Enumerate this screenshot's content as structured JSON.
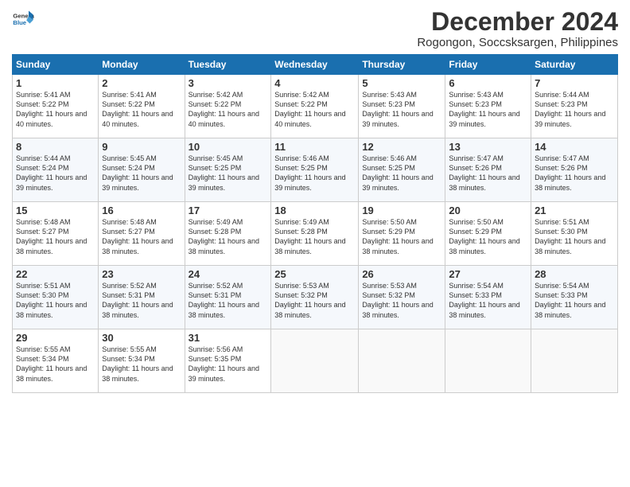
{
  "logo": {
    "general": "General",
    "blue": "Blue"
  },
  "title": "December 2024",
  "subtitle": "Rogongon, Soccsksargen, Philippines",
  "days_header": [
    "Sunday",
    "Monday",
    "Tuesday",
    "Wednesday",
    "Thursday",
    "Friday",
    "Saturday"
  ],
  "weeks": [
    [
      {
        "day": "1",
        "sunrise": "Sunrise: 5:41 AM",
        "sunset": "Sunset: 5:22 PM",
        "daylight": "Daylight: 11 hours and 40 minutes."
      },
      {
        "day": "2",
        "sunrise": "Sunrise: 5:41 AM",
        "sunset": "Sunset: 5:22 PM",
        "daylight": "Daylight: 11 hours and 40 minutes."
      },
      {
        "day": "3",
        "sunrise": "Sunrise: 5:42 AM",
        "sunset": "Sunset: 5:22 PM",
        "daylight": "Daylight: 11 hours and 40 minutes."
      },
      {
        "day": "4",
        "sunrise": "Sunrise: 5:42 AM",
        "sunset": "Sunset: 5:22 PM",
        "daylight": "Daylight: 11 hours and 40 minutes."
      },
      {
        "day": "5",
        "sunrise": "Sunrise: 5:43 AM",
        "sunset": "Sunset: 5:23 PM",
        "daylight": "Daylight: 11 hours and 39 minutes."
      },
      {
        "day": "6",
        "sunrise": "Sunrise: 5:43 AM",
        "sunset": "Sunset: 5:23 PM",
        "daylight": "Daylight: 11 hours and 39 minutes."
      },
      {
        "day": "7",
        "sunrise": "Sunrise: 5:44 AM",
        "sunset": "Sunset: 5:23 PM",
        "daylight": "Daylight: 11 hours and 39 minutes."
      }
    ],
    [
      {
        "day": "8",
        "sunrise": "Sunrise: 5:44 AM",
        "sunset": "Sunset: 5:24 PM",
        "daylight": "Daylight: 11 hours and 39 minutes."
      },
      {
        "day": "9",
        "sunrise": "Sunrise: 5:45 AM",
        "sunset": "Sunset: 5:24 PM",
        "daylight": "Daylight: 11 hours and 39 minutes."
      },
      {
        "day": "10",
        "sunrise": "Sunrise: 5:45 AM",
        "sunset": "Sunset: 5:25 PM",
        "daylight": "Daylight: 11 hours and 39 minutes."
      },
      {
        "day": "11",
        "sunrise": "Sunrise: 5:46 AM",
        "sunset": "Sunset: 5:25 PM",
        "daylight": "Daylight: 11 hours and 39 minutes."
      },
      {
        "day": "12",
        "sunrise": "Sunrise: 5:46 AM",
        "sunset": "Sunset: 5:25 PM",
        "daylight": "Daylight: 11 hours and 39 minutes."
      },
      {
        "day": "13",
        "sunrise": "Sunrise: 5:47 AM",
        "sunset": "Sunset: 5:26 PM",
        "daylight": "Daylight: 11 hours and 38 minutes."
      },
      {
        "day": "14",
        "sunrise": "Sunrise: 5:47 AM",
        "sunset": "Sunset: 5:26 PM",
        "daylight": "Daylight: 11 hours and 38 minutes."
      }
    ],
    [
      {
        "day": "15",
        "sunrise": "Sunrise: 5:48 AM",
        "sunset": "Sunset: 5:27 PM",
        "daylight": "Daylight: 11 hours and 38 minutes."
      },
      {
        "day": "16",
        "sunrise": "Sunrise: 5:48 AM",
        "sunset": "Sunset: 5:27 PM",
        "daylight": "Daylight: 11 hours and 38 minutes."
      },
      {
        "day": "17",
        "sunrise": "Sunrise: 5:49 AM",
        "sunset": "Sunset: 5:28 PM",
        "daylight": "Daylight: 11 hours and 38 minutes."
      },
      {
        "day": "18",
        "sunrise": "Sunrise: 5:49 AM",
        "sunset": "Sunset: 5:28 PM",
        "daylight": "Daylight: 11 hours and 38 minutes."
      },
      {
        "day": "19",
        "sunrise": "Sunrise: 5:50 AM",
        "sunset": "Sunset: 5:29 PM",
        "daylight": "Daylight: 11 hours and 38 minutes."
      },
      {
        "day": "20",
        "sunrise": "Sunrise: 5:50 AM",
        "sunset": "Sunset: 5:29 PM",
        "daylight": "Daylight: 11 hours and 38 minutes."
      },
      {
        "day": "21",
        "sunrise": "Sunrise: 5:51 AM",
        "sunset": "Sunset: 5:30 PM",
        "daylight": "Daylight: 11 hours and 38 minutes."
      }
    ],
    [
      {
        "day": "22",
        "sunrise": "Sunrise: 5:51 AM",
        "sunset": "Sunset: 5:30 PM",
        "daylight": "Daylight: 11 hours and 38 minutes."
      },
      {
        "day": "23",
        "sunrise": "Sunrise: 5:52 AM",
        "sunset": "Sunset: 5:31 PM",
        "daylight": "Daylight: 11 hours and 38 minutes."
      },
      {
        "day": "24",
        "sunrise": "Sunrise: 5:52 AM",
        "sunset": "Sunset: 5:31 PM",
        "daylight": "Daylight: 11 hours and 38 minutes."
      },
      {
        "day": "25",
        "sunrise": "Sunrise: 5:53 AM",
        "sunset": "Sunset: 5:32 PM",
        "daylight": "Daylight: 11 hours and 38 minutes."
      },
      {
        "day": "26",
        "sunrise": "Sunrise: 5:53 AM",
        "sunset": "Sunset: 5:32 PM",
        "daylight": "Daylight: 11 hours and 38 minutes."
      },
      {
        "day": "27",
        "sunrise": "Sunrise: 5:54 AM",
        "sunset": "Sunset: 5:33 PM",
        "daylight": "Daylight: 11 hours and 38 minutes."
      },
      {
        "day": "28",
        "sunrise": "Sunrise: 5:54 AM",
        "sunset": "Sunset: 5:33 PM",
        "daylight": "Daylight: 11 hours and 38 minutes."
      }
    ],
    [
      {
        "day": "29",
        "sunrise": "Sunrise: 5:55 AM",
        "sunset": "Sunset: 5:34 PM",
        "daylight": "Daylight: 11 hours and 38 minutes."
      },
      {
        "day": "30",
        "sunrise": "Sunrise: 5:55 AM",
        "sunset": "Sunset: 5:34 PM",
        "daylight": "Daylight: 11 hours and 38 minutes."
      },
      {
        "day": "31",
        "sunrise": "Sunrise: 5:56 AM",
        "sunset": "Sunset: 5:35 PM",
        "daylight": "Daylight: 11 hours and 39 minutes."
      },
      null,
      null,
      null,
      null
    ]
  ]
}
